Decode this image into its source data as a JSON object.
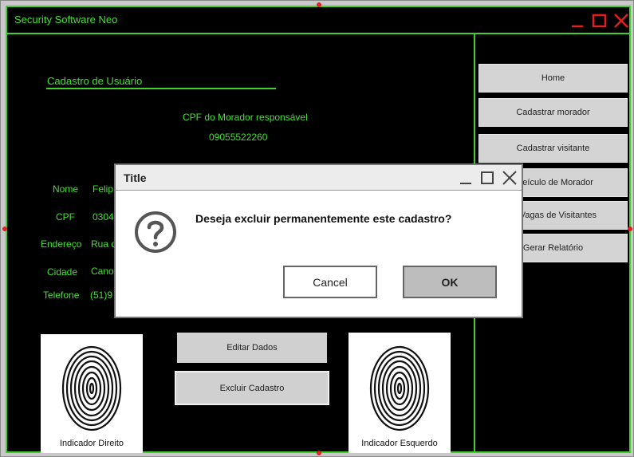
{
  "app": {
    "title": "Security Software Neo"
  },
  "form": {
    "heading": "Cadastro de Usuário",
    "cpf_responsavel_label": "CPF do Morador responsável",
    "cpf_responsavel_value": "09055522260",
    "fields": [
      {
        "label": "Nome",
        "value": "Felip"
      },
      {
        "label": "CPF",
        "value": "0304"
      },
      {
        "label": "Endereço",
        "value": "Rua d"
      },
      {
        "label": "Cidade",
        "value": "Cano"
      },
      {
        "label": "Telefone",
        "value": "(51)9"
      }
    ]
  },
  "nav": {
    "items": [
      "Home",
      "Cadastrar morador",
      "Cadastrar visitante",
      "r veículo de Morador",
      "ar Vagas de Visitantes",
      "Gerar Relatório"
    ]
  },
  "actions": {
    "edit": "Editar Dados",
    "delete": "Excluir Cadastro"
  },
  "fingerprints": {
    "right": "Indicador Direito",
    "left": "Indicador Esquerdo"
  },
  "dialog": {
    "title": "Title",
    "message": "Deseja excluir permanentemente este cadastro?",
    "cancel": "Cancel",
    "ok": "OK"
  },
  "colors": {
    "accent": "#3fd12a",
    "background": "#000000",
    "button": "#d0d0d0",
    "close_red": "#e02020"
  }
}
